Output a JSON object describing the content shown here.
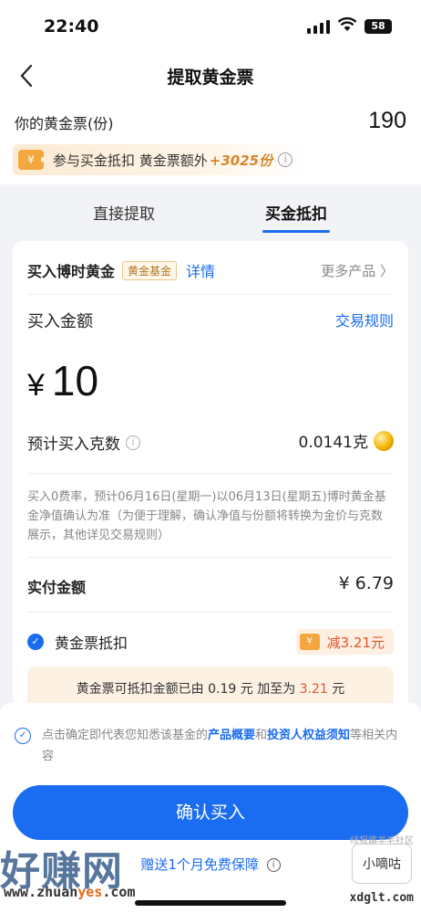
{
  "status_bar": {
    "time": "22:40",
    "battery": "58"
  },
  "nav": {
    "title": "提取黄金票"
  },
  "ticket": {
    "label": "你的黄金票(份)",
    "count": "190",
    "promo_icon": "¥",
    "promo_text": "参与买金抵扣 黄金票额外",
    "promo_highlight": "+3025份"
  },
  "tabs": [
    {
      "label": "直接提取",
      "active": false
    },
    {
      "label": "买金抵扣",
      "active": true
    }
  ],
  "product": {
    "name": "买入博时黄金",
    "tag": "黄金基金",
    "detail_link": "详情",
    "more_link": "更多产品"
  },
  "purchase": {
    "amount_label": "买入金额",
    "rules_link": "交易规则",
    "currency": "¥",
    "amount": "10",
    "grams_label": "预计买入克数",
    "grams_value": "0.0141克",
    "note": "买入0费率，预计06月16日(星期一)以06月13日(星期五)博时黄金基金净值确认为准（为便于理解，确认净值与份额将转换为金价与克数展示，其他详见交易规则）",
    "pay_label": "实付金额",
    "pay_value": "¥ 6.79",
    "deduct_label": "黄金票抵扣",
    "deduct_badge": "减3.21元",
    "tip_prefix": "黄金票可抵扣金额已由",
    "tip_from": "0.19",
    "tip_mid": "元 加至为",
    "tip_to": "3.21",
    "tip_suffix": "元"
  },
  "footer": {
    "agree_prefix": "点击确定即代表您知悉该基金的",
    "agree_link1": "产品概要",
    "agree_and": "和",
    "agree_link2": "投资人权益须知",
    "agree_suffix": "等相关内容",
    "confirm_button": "确认买入",
    "guarantee_text": "赠送1个月免费保障"
  },
  "watermarks": {
    "brand": "好赚网",
    "url_a": "www.zhuan",
    "url_b": "yes",
    "url_c": ".com",
    "right_badge": "小嘀咕",
    "right_top": "线报薅羊毛社区",
    "right_url": "xdglt.com"
  },
  "colors": {
    "accent": "#1a6cf0",
    "gold": "#f3a73e",
    "discount_red": "#e5532b"
  }
}
